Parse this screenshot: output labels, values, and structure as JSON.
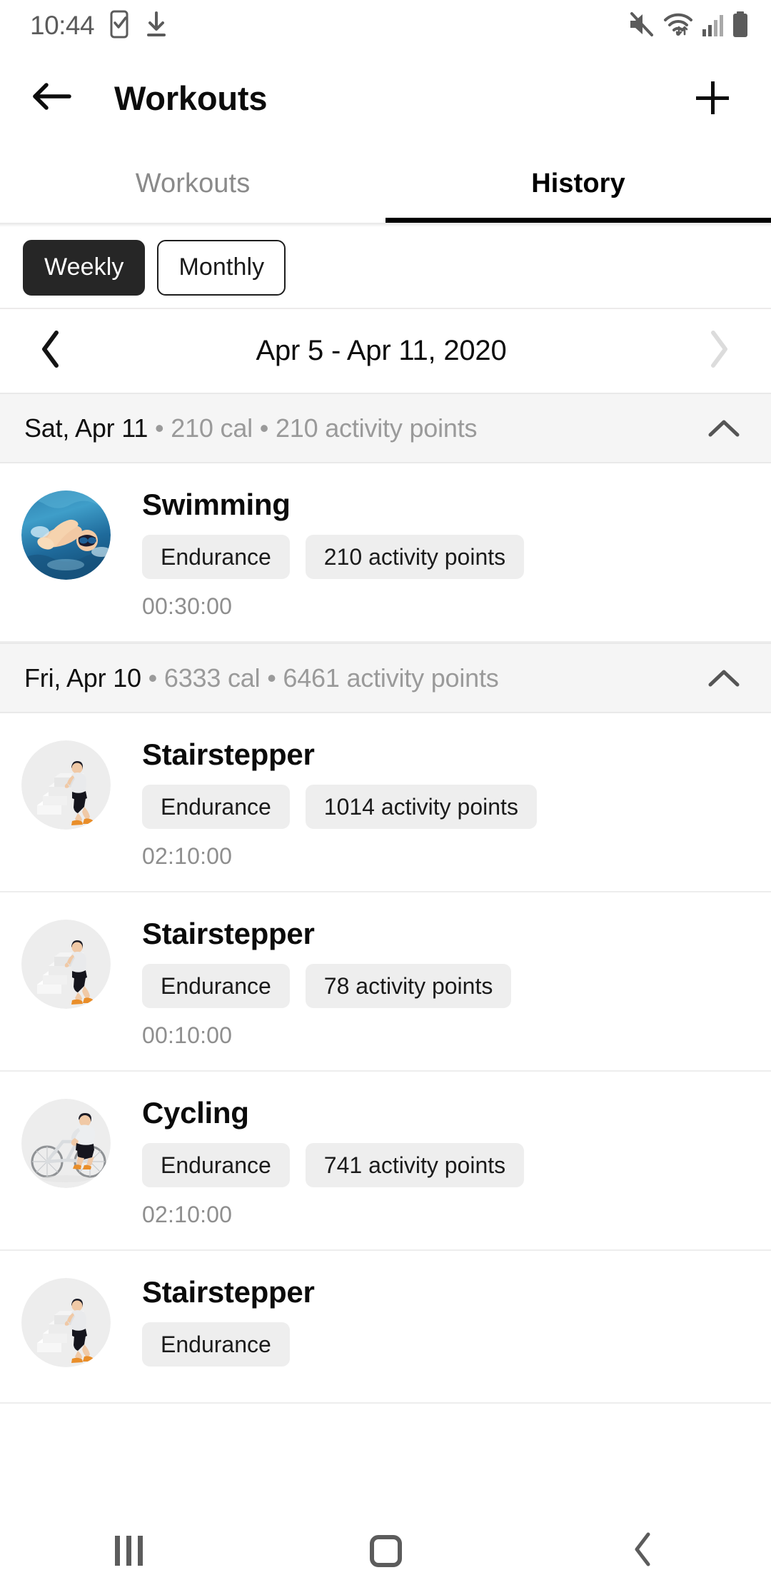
{
  "status_bar": {
    "time": "10:44",
    "left_icons": [
      "phone-check-icon",
      "download-icon"
    ],
    "right_icons": [
      "mute-icon",
      "wifi-icon",
      "cellular-signal-icon",
      "battery-icon"
    ]
  },
  "app_bar": {
    "back_icon": "arrow-left-icon",
    "title": "Workouts",
    "add_icon": "plus-icon"
  },
  "tabs": [
    {
      "label": "Workouts",
      "active": false
    },
    {
      "label": "History",
      "active": true
    }
  ],
  "period_toggle": {
    "options": [
      {
        "label": "Weekly",
        "selected": true
      },
      {
        "label": "Monthly",
        "selected": false
      }
    ]
  },
  "date_nav": {
    "prev_icon": "chevron-left-icon",
    "range_label": "Apr 5 - Apr 11, 2020",
    "next_icon": "chevron-right-icon",
    "prev_enabled": true,
    "next_enabled": false
  },
  "day_groups": [
    {
      "date_label": "Sat, Apr 11",
      "meta": " • 210 cal • 210 activity points",
      "collapse_icon": "chevron-up-icon",
      "workouts": [
        {
          "title": "Swimming",
          "type_chip": "Endurance",
          "points_chip": "210 activity points",
          "duration": "00:30:00",
          "thumb": "swimming-photo"
        }
      ]
    },
    {
      "date_label": "Fri, Apr 10",
      "meta": " • 6333 cal • 6461 activity points",
      "collapse_icon": "chevron-up-icon",
      "workouts": [
        {
          "title": "Stairstepper",
          "type_chip": "Endurance",
          "points_chip": "1014 activity points",
          "duration": "02:10:00",
          "thumb": "stairstepper-illustration"
        },
        {
          "title": "Stairstepper",
          "type_chip": "Endurance",
          "points_chip": "78 activity points",
          "duration": "00:10:00",
          "thumb": "stairstepper-illustration"
        },
        {
          "title": "Cycling",
          "type_chip": "Endurance",
          "points_chip": "741 activity points",
          "duration": "02:10:00",
          "thumb": "cycling-illustration"
        },
        {
          "title": "Stairstepper",
          "type_chip": "Endurance",
          "points_chip": "",
          "duration": "",
          "thumb": "stairstepper-illustration"
        }
      ]
    }
  ],
  "nav_bar": {
    "recents_icon": "recents-icon",
    "home_icon": "home-icon",
    "back_icon": "nav-back-icon"
  },
  "colors": {
    "accent_dark": "#262626",
    "tab_active": "#000000",
    "tab_inactive": "#8a8a8a",
    "meta_gray": "#9a9a9a",
    "chip_bg": "#eeeeee",
    "group_header_bg": "#f5f5f5"
  }
}
